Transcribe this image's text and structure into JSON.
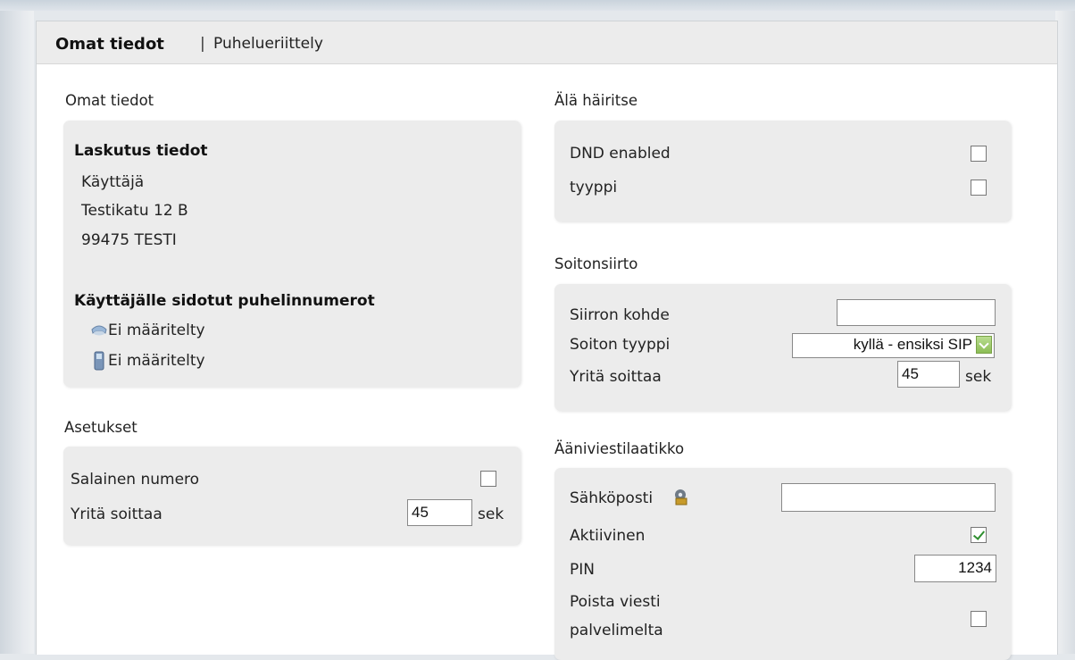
{
  "header": {
    "active_tab": "Omat tiedot",
    "separator": "|",
    "other_tab": "Puhelueriittely"
  },
  "own_info": {
    "section_title": "Omat tiedot",
    "billing_title": "Laskutus tiedot",
    "user": "Käyttäjä",
    "street": "Testikatu 12 B",
    "postal": "99475 TESTI",
    "numbers_title": "Käyttäjälle sidotut puhelinnumerot",
    "landline_number": "Ei määritelty",
    "mobile_number": "Ei määritelty"
  },
  "settings": {
    "section_title": "Asetukset",
    "secret_label": "Salainen numero",
    "secret_checked": false,
    "try_call_label": "Yritä soittaa",
    "try_call_value": "45",
    "unit": "sek"
  },
  "dnd": {
    "section_title": "Älä häiritse",
    "enabled_label": "DND enabled",
    "enabled_checked": false,
    "type_label": "tyyppi",
    "type_checked": false
  },
  "forwarding": {
    "section_title": "Soitonsiirto",
    "target_label": "Siirron kohde",
    "target_value": "",
    "call_type_label": "Soiton tyyppi",
    "call_type_selected": "kyllä - ensiksi SIP",
    "try_call_label": "Yritä soittaa",
    "try_call_value": "45",
    "unit": "sek"
  },
  "voicemail": {
    "section_title": "Ääniviestilaatikko",
    "email_label": "Sähköposti",
    "email_value": "",
    "active_label": "Aktiivinen",
    "active_checked": true,
    "pin_label": "PIN",
    "pin_value": "1234",
    "delete_label_1": "Poista viesti",
    "delete_label_2": "palvelimelta",
    "delete_checked": false
  },
  "colors": {
    "panel_bg": "#ececec",
    "check_green": "#2f8f2f",
    "select_arrow_green": "#8cbd55"
  }
}
